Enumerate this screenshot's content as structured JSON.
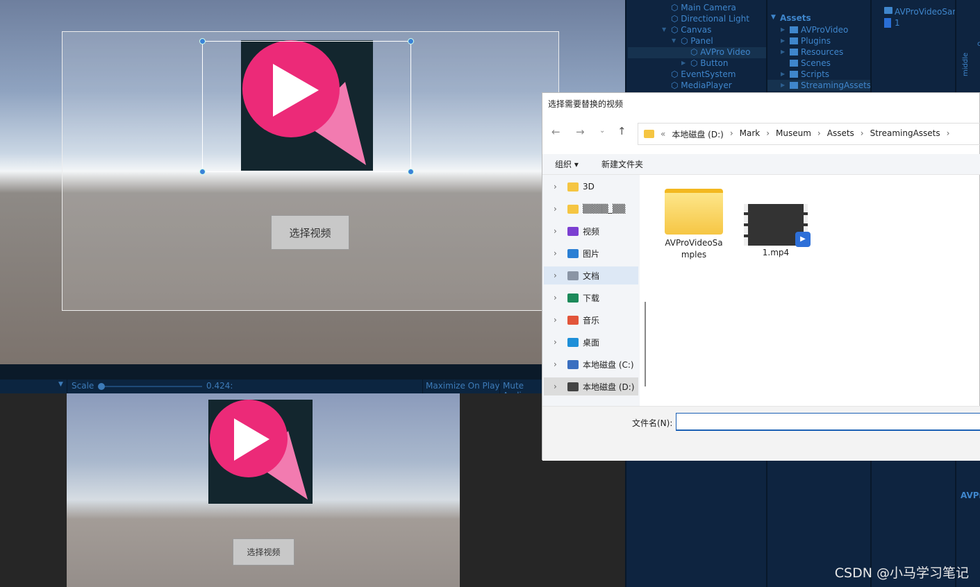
{
  "scene": {
    "button_label": "选择视频"
  },
  "game_toolbar": {
    "scale_label": "Scale",
    "scale_value": "0.424:",
    "scale_fraction": 0.04,
    "maximize": "Maximize On Play",
    "mute": "Mute Audi"
  },
  "game": {
    "button_label": "选择视频"
  },
  "hierarchy": {
    "items": [
      {
        "label": "Main Camera",
        "indent": 1
      },
      {
        "label": "Directional Light",
        "indent": 1
      },
      {
        "label": "Canvas",
        "indent": 1,
        "expanded": true
      },
      {
        "label": "Panel",
        "indent": 2,
        "expanded": true
      },
      {
        "label": "AVPro Video",
        "indent": 3,
        "selected": true
      },
      {
        "label": "Button",
        "indent": 3,
        "collapsed": true
      },
      {
        "label": "EventSystem",
        "indent": 1
      },
      {
        "label": "MediaPlayer",
        "indent": 1
      }
    ]
  },
  "project": {
    "root": "Assets",
    "folders": [
      "AVProVideo",
      "Plugins",
      "Resources",
      "Scenes",
      "Scripts",
      "StreamingAssets"
    ],
    "files": [
      "AVProVideoSar",
      "1"
    ],
    "inspector_label": "middle",
    "inspector_bottom": "AVPr",
    "inspector_short": "ce"
  },
  "dialog": {
    "title": "选择需要替换的视频",
    "breadcrumb": [
      "本地磁盘 (D:)",
      "Mark",
      "Museum",
      "Assets",
      "StreamingAssets"
    ],
    "organize": "组织",
    "new_folder": "新建文件夹",
    "nav": [
      {
        "label": "3D",
        "icon": "folder-icon",
        "color": "#f5c542"
      },
      {
        "label": "▒▒▒▒_▒▒",
        "icon": "folder-icon",
        "color": "#f5c542"
      },
      {
        "label": "视频",
        "icon": "video-icon",
        "color": "#7b3fd1"
      },
      {
        "label": "图片",
        "icon": "picture-icon",
        "color": "#2a7fd4"
      },
      {
        "label": "文档",
        "icon": "document-icon",
        "color": "#8a95a5",
        "selected": true
      },
      {
        "label": "下载",
        "icon": "download-icon",
        "color": "#1c8a5a"
      },
      {
        "label": "音乐",
        "icon": "music-icon",
        "color": "#e2553a"
      },
      {
        "label": "桌面",
        "icon": "desktop-icon",
        "color": "#1e8fd8"
      },
      {
        "label": "本地磁盘 (C:)",
        "icon": "drive-icon",
        "color": "#3a6fc0"
      },
      {
        "label": "本地磁盘 (D:)",
        "icon": "drive-icon",
        "color": "#444",
        "active": true
      }
    ],
    "files": [
      {
        "name": "AVProVideoSamples",
        "type": "folder"
      },
      {
        "name": "1.mp4",
        "type": "video"
      }
    ],
    "filename_label": "文件名(N):",
    "filename_value": ""
  },
  "watermark": "CSDN @小马学习笔记"
}
